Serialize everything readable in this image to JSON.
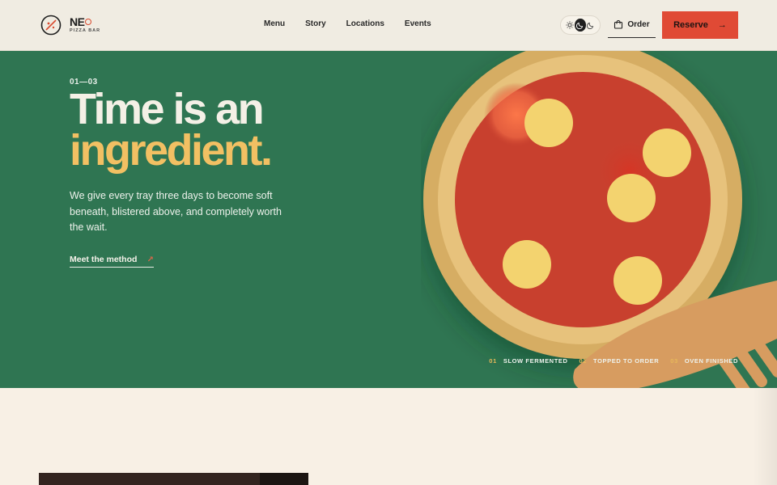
{
  "brand": {
    "name": "NE",
    "subtitle": "PIZZA BAR"
  },
  "nav": {
    "items": [
      "Menu",
      "Story",
      "Locations",
      "Events"
    ]
  },
  "header": {
    "order_label": "Order",
    "reserve_label": "Reserve",
    "reserve_arrow": "→"
  },
  "theme": {
    "options": [
      "light",
      "dark",
      "auto"
    ],
    "selected": "dark"
  },
  "hero": {
    "counter": "01—03",
    "title_line1": "Time is an",
    "title_line2": "ingredient.",
    "lead": "We give every tray three days to become soft beneath, blistered above, and completely worth the wait.",
    "cta_label": "Meet the method",
    "cta_arrow": "↗"
  },
  "steps": [
    {
      "num": "01",
      "label": "SLOW FERMENTED"
    },
    {
      "num": "02",
      "label": "TOPPED TO ORDER"
    },
    {
      "num": "03",
      "label": "OVEN FINISHED"
    }
  ],
  "colors": {
    "hero_bg": "#2f7552",
    "accent_yellow": "#f2c063",
    "accent_red": "#e04a35",
    "page_bg": "#f8f0e5",
    "sauce": "#c8402e",
    "crust": "#dcb46a",
    "cheese": "#f3d36f"
  }
}
